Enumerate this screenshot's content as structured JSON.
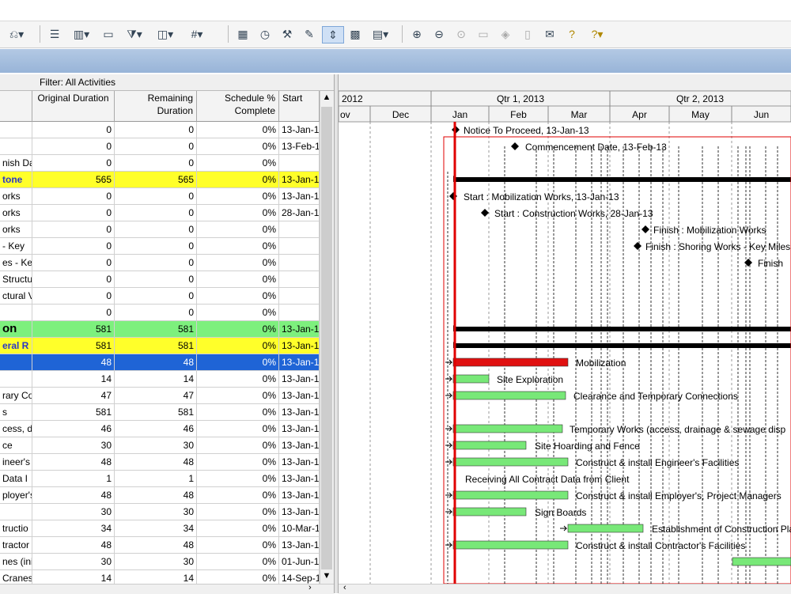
{
  "toolbar": {
    "icons": [
      "undo-dropdown-icon",
      "bars-icon",
      "columns-icon",
      "layout-icon",
      "filter-icon",
      "group-icon",
      "hash-icon",
      "table-icon",
      "schedule-icon",
      "network-icon",
      "tools-icon",
      "progress-line-icon",
      "assign-icon",
      "details-icon",
      "zoom-in-icon",
      "zoom-out-icon",
      "zoom-fit-icon",
      "split-icon",
      "diamond-icon",
      "page-icon",
      "comment-icon",
      "help-icon",
      "help-dropdown-icon"
    ]
  },
  "filter": {
    "label": "Filter: All Activities"
  },
  "columns": {
    "orig": "Original Duration",
    "rem_line1": "Remaining",
    "rem_line2": "Duration",
    "pct_line1": "Schedule %",
    "pct_line2": "Complete",
    "start": "Start"
  },
  "rows": [
    {
      "name": "",
      "orig": "0",
      "rem": "0",
      "pct": "0%",
      "start": "13-Jan-1",
      "style": ""
    },
    {
      "name": "",
      "orig": "0",
      "rem": "0",
      "pct": "0%",
      "start": "13-Feb-1",
      "style": ""
    },
    {
      "name": "nish Da",
      "orig": "0",
      "rem": "0",
      "pct": "0%",
      "start": "",
      "style": ""
    },
    {
      "name": "tone",
      "orig": "565",
      "rem": "565",
      "pct": "0%",
      "start": "13-Jan-1",
      "style": "yellow"
    },
    {
      "name": "orks",
      "orig": "0",
      "rem": "0",
      "pct": "0%",
      "start": "13-Jan-1",
      "style": ""
    },
    {
      "name": "orks",
      "orig": "0",
      "rem": "0",
      "pct": "0%",
      "start": "28-Jan-1",
      "style": ""
    },
    {
      "name": "orks",
      "orig": "0",
      "rem": "0",
      "pct": "0%",
      "start": "",
      "style": ""
    },
    {
      "name": "- Key",
      "orig": "0",
      "rem": "0",
      "pct": "0%",
      "start": "",
      "style": ""
    },
    {
      "name": "es - Ke",
      "orig": "0",
      "rem": "0",
      "pct": "0%",
      "start": "",
      "style": ""
    },
    {
      "name": "Structu",
      "orig": "0",
      "rem": "0",
      "pct": "0%",
      "start": "",
      "style": ""
    },
    {
      "name": "ctural V",
      "orig": "0",
      "rem": "0",
      "pct": "0%",
      "start": "",
      "style": ""
    },
    {
      "name": "",
      "orig": "0",
      "rem": "0",
      "pct": "0%",
      "start": "",
      "style": ""
    },
    {
      "name": "on",
      "orig": "581",
      "rem": "581",
      "pct": "0%",
      "start": "13-Jan-1",
      "style": "green"
    },
    {
      "name": "eral R",
      "orig": "581",
      "rem": "581",
      "pct": "0%",
      "start": "13-Jan-1",
      "style": "yellow"
    },
    {
      "name": "",
      "orig": "48",
      "rem": "48",
      "pct": "0%",
      "start": "13-Jan-1",
      "style": "blue"
    },
    {
      "name": "",
      "orig": "14",
      "rem": "14",
      "pct": "0%",
      "start": "13-Jan-1",
      "style": ""
    },
    {
      "name": "rary Co",
      "orig": "47",
      "rem": "47",
      "pct": "0%",
      "start": "13-Jan-1",
      "style": ""
    },
    {
      "name": "s",
      "orig": "581",
      "rem": "581",
      "pct": "0%",
      "start": "13-Jan-1",
      "style": ""
    },
    {
      "name": "cess, d",
      "orig": "46",
      "rem": "46",
      "pct": "0%",
      "start": "13-Jan-1",
      "style": ""
    },
    {
      "name": "ce",
      "orig": "30",
      "rem": "30",
      "pct": "0%",
      "start": "13-Jan-1",
      "style": ""
    },
    {
      "name": "ineer's",
      "orig": "48",
      "rem": "48",
      "pct": "0%",
      "start": "13-Jan-1",
      "style": ""
    },
    {
      "name": "Data I",
      "orig": "1",
      "rem": "1",
      "pct": "0%",
      "start": "13-Jan-1",
      "style": ""
    },
    {
      "name": "ployer's",
      "orig": "48",
      "rem": "48",
      "pct": "0%",
      "start": "13-Jan-1",
      "style": ""
    },
    {
      "name": "",
      "orig": "30",
      "rem": "30",
      "pct": "0%",
      "start": "13-Jan-1",
      "style": ""
    },
    {
      "name": "tructio",
      "orig": "34",
      "rem": "34",
      "pct": "0%",
      "start": "10-Mar-1",
      "style": ""
    },
    {
      "name": "tractor",
      "orig": "48",
      "rem": "48",
      "pct": "0%",
      "start": "13-Jan-1",
      "style": ""
    },
    {
      "name": "nes (ini",
      "orig": "30",
      "rem": "30",
      "pct": "0%",
      "start": "01-Jun-1",
      "style": ""
    },
    {
      "name": "Cranes",
      "orig": "14",
      "rem": "14",
      "pct": "0%",
      "start": "14-Sep-1",
      "style": ""
    }
  ],
  "timescale": {
    "top": [
      "2012",
      "Qtr 1, 2013",
      "Qtr 2, 2013"
    ],
    "months": [
      "ov",
      "Dec",
      "Jan",
      "Feb",
      "Mar",
      "Apr",
      "May",
      "Jun"
    ]
  },
  "gantt_labels": [
    "Notice To Proceed, 13-Jan-13",
    "Commencement Date, 13-Feb-13",
    "Start : Mobilization Works, 13-Jan-13",
    "Start : Construction Works, 28-Jan-13",
    "Finish : Mobilization Works",
    "Finish : Shoring Works - Key Miles",
    "Finish",
    "Mobilization",
    "Site Exploration",
    "Clearance and Temporary Connections",
    "Temporary Works (access, drainage & sewage disp",
    "Site Hoarding and Fence",
    "Construct & install Engineer's Facilities",
    "Receiving All Contract Data from Client",
    "Construct & install Employer's, Project Managers",
    "Sign Boards",
    "Establishment of Construction Pla",
    "Construct & install Contractor's Facilities"
  ],
  "colors": {
    "yellow_row": "#ffff2a",
    "green_row": "#7df07d",
    "selected_row": "#1f64d6",
    "bar_green": "#78e878",
    "bar_red": "#e01010",
    "data_date": "#e00000"
  }
}
